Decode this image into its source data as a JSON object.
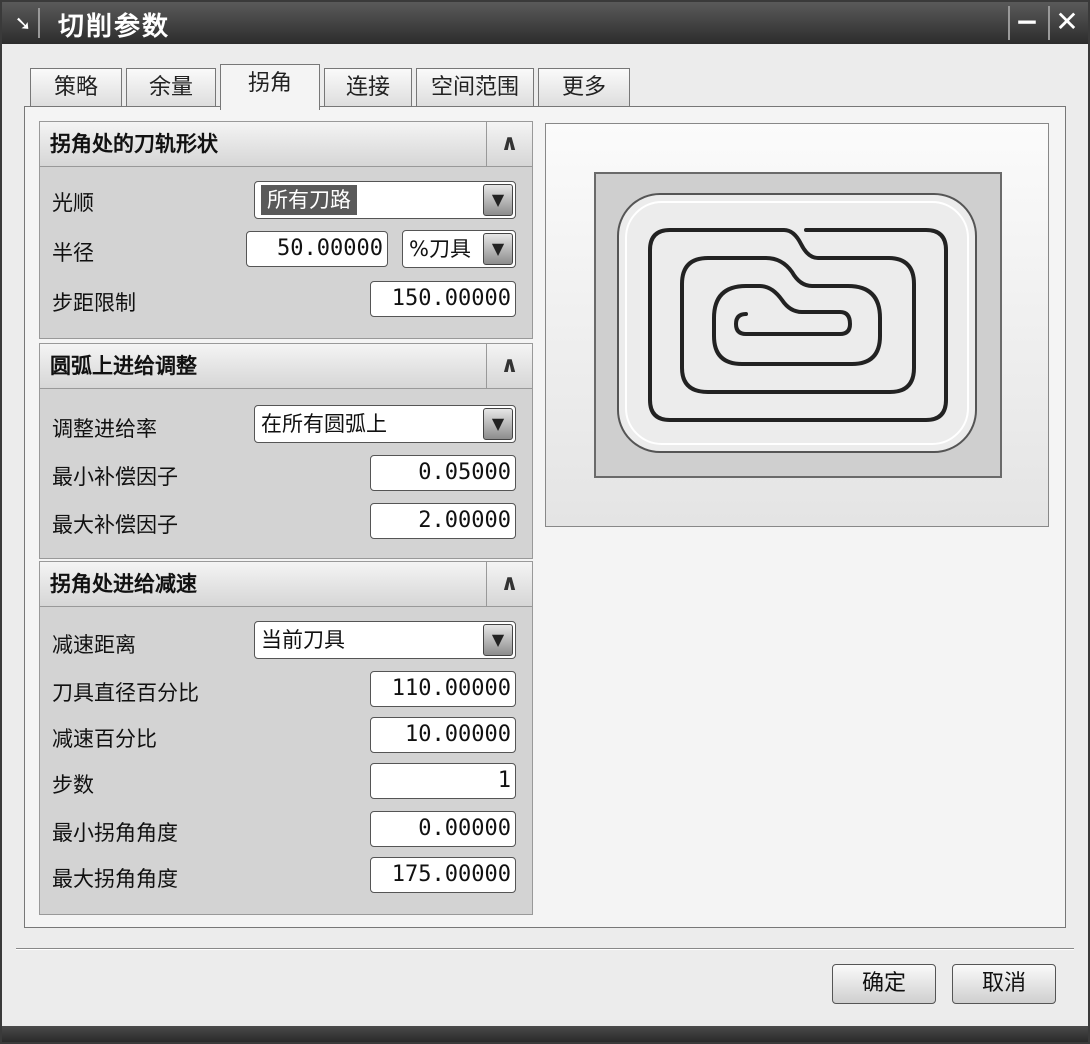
{
  "window": {
    "title": "切削参数",
    "title_icon": "arrow-cursor-icon",
    "minimize_glyph": "−",
    "close_glyph": "✕"
  },
  "tabs": [
    {
      "label": "策略",
      "active": false
    },
    {
      "label": "余量",
      "active": false
    },
    {
      "label": "拐角",
      "active": true
    },
    {
      "label": "连接",
      "active": false
    },
    {
      "label": "空间范围",
      "active": false
    },
    {
      "label": "更多",
      "active": false
    }
  ],
  "section1": {
    "title": "拐角处的刀轨形状",
    "rows": {
      "smooth": {
        "label": "光顺",
        "value": "所有刀路"
      },
      "radius": {
        "label": "半径",
        "value": "50.00000",
        "unit": "%刀具"
      },
      "step_limit": {
        "label": "步距限制",
        "value": "150.00000"
      }
    }
  },
  "section2": {
    "title": "圆弧上进给调整",
    "rows": {
      "adjust_rate": {
        "label": "调整进给率",
        "value": "在所有圆弧上"
      },
      "min_comp": {
        "label": "最小补偿因子",
        "value": "0.05000"
      },
      "max_comp": {
        "label": "最大补偿因子",
        "value": "2.00000"
      }
    }
  },
  "section3": {
    "title": "拐角处进给减速",
    "rows": {
      "decel_dist": {
        "label": "减速距离",
        "value": "当前刀具"
      },
      "tool_dia_pct": {
        "label": "刀具直径百分比",
        "value": "110.00000"
      },
      "decel_pct": {
        "label": "减速百分比",
        "value": "10.00000"
      },
      "steps": {
        "label": "步数",
        "value": "1"
      },
      "min_angle": {
        "label": "最小拐角角度",
        "value": "0.00000"
      },
      "max_angle": {
        "label": "最大拐角角度",
        "value": "175.00000"
      }
    }
  },
  "buttons": {
    "ok": "确定",
    "cancel": "取消"
  },
  "collapse_glyph": "∧",
  "dropdown_glyph": "▼",
  "colors": {
    "titlebar": "#2c2c2c",
    "selected_highlight": "#5a5a5a",
    "section_body": "#d3d3d3"
  }
}
